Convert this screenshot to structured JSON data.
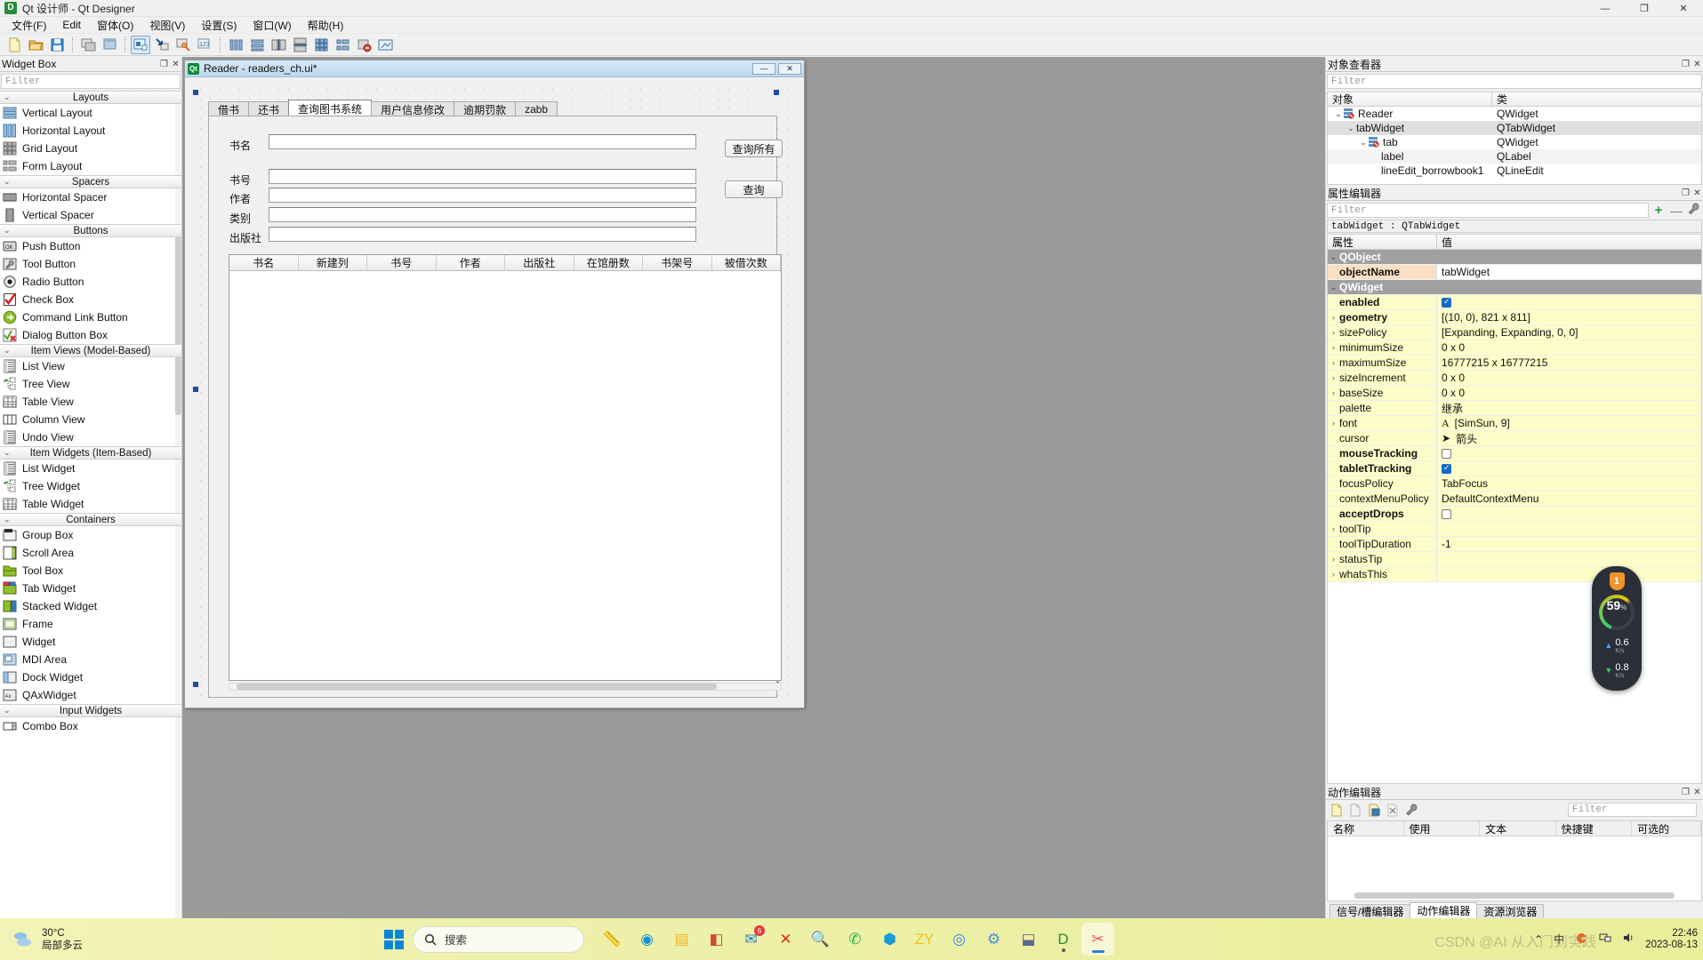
{
  "window": {
    "app_icon": "D",
    "title": "Qt 设计师 - Qt Designer",
    "minimize": "—",
    "maximize": "❐",
    "close": "✕"
  },
  "menubar": {
    "items": [
      "文件(F)",
      "Edit",
      "窗体(O)",
      "视图(V)",
      "设置(S)",
      "窗口(W)",
      "帮助(H)"
    ]
  },
  "toolbar": {
    "groups": [
      [
        "new-file-icon",
        "open-folder-icon",
        "save-icon"
      ],
      [
        "form-preview-icon",
        "form-layout-icon"
      ],
      [
        "edit-widgets-icon",
        "edit-signals-icon",
        "edit-buddies-icon",
        "edit-tab-order-icon"
      ],
      [
        "layout-horizontal-icon",
        "layout-vertical-icon",
        "layout-splitter-h-icon",
        "layout-splitter-v-icon",
        "layout-grid-icon",
        "layout-form-icon",
        "break-layout-icon",
        "adjust-size-icon"
      ]
    ]
  },
  "widget_box": {
    "title": "Widget Box",
    "float_btn": "❐",
    "close_btn": "✕",
    "filter_placeholder": "Filter",
    "categories": [
      {
        "name": "Layouts",
        "items": [
          {
            "label": "Vertical Layout",
            "icon": "vertical-layout-icon"
          },
          {
            "label": "Horizontal Layout",
            "icon": "horizontal-layout-icon"
          },
          {
            "label": "Grid Layout",
            "icon": "grid-layout-icon"
          },
          {
            "label": "Form Layout",
            "icon": "form-layout-icon"
          }
        ]
      },
      {
        "name": "Spacers",
        "items": [
          {
            "label": "Horizontal Spacer",
            "icon": "horizontal-spacer-icon"
          },
          {
            "label": "Vertical Spacer",
            "icon": "vertical-spacer-icon"
          }
        ]
      },
      {
        "name": "Buttons",
        "items": [
          {
            "label": "Push Button",
            "icon": "push-button-icon"
          },
          {
            "label": "Tool Button",
            "icon": "tool-button-icon"
          },
          {
            "label": "Radio Button",
            "icon": "radio-button-icon"
          },
          {
            "label": "Check Box",
            "icon": "check-box-icon"
          },
          {
            "label": "Command Link Button",
            "icon": "command-link-icon"
          },
          {
            "label": "Dialog Button Box",
            "icon": "dialog-button-box-icon"
          }
        ]
      },
      {
        "name": "Item Views (Model-Based)",
        "items": [
          {
            "label": "List View",
            "icon": "list-view-icon"
          },
          {
            "label": "Tree View",
            "icon": "tree-view-icon"
          },
          {
            "label": "Table View",
            "icon": "table-view-icon"
          },
          {
            "label": "Column View",
            "icon": "column-view-icon"
          },
          {
            "label": "Undo View",
            "icon": "undo-view-icon"
          }
        ]
      },
      {
        "name": "Item Widgets (Item-Based)",
        "items": [
          {
            "label": "List Widget",
            "icon": "list-widget-icon"
          },
          {
            "label": "Tree Widget",
            "icon": "tree-widget-icon"
          },
          {
            "label": "Table Widget",
            "icon": "table-widget-icon"
          }
        ]
      },
      {
        "name": "Containers",
        "items": [
          {
            "label": "Group Box",
            "icon": "group-box-icon"
          },
          {
            "label": "Scroll Area",
            "icon": "scroll-area-icon"
          },
          {
            "label": "Tool Box",
            "icon": "tool-box-icon"
          },
          {
            "label": "Tab Widget",
            "icon": "tab-widget-icon"
          },
          {
            "label": "Stacked Widget",
            "icon": "stacked-widget-icon"
          },
          {
            "label": "Frame",
            "icon": "frame-icon"
          },
          {
            "label": "Widget",
            "icon": "widget-icon"
          },
          {
            "label": "MDI Area",
            "icon": "mdi-area-icon"
          },
          {
            "label": "Dock Widget",
            "icon": "dock-widget-icon"
          },
          {
            "label": "QAxWidget",
            "icon": "qax-widget-icon"
          }
        ]
      },
      {
        "name": "Input Widgets",
        "items": [
          {
            "label": "Combo Box",
            "icon": "combo-box-icon"
          }
        ]
      }
    ]
  },
  "form_window": {
    "icon": "Qt",
    "title": "Reader - readers_ch.ui*",
    "minimize": "—",
    "close": "✕",
    "tabs": [
      "借书",
      "还书",
      "查询图书系统",
      "用户信息修改",
      "逾期罚款",
      "zabb"
    ],
    "selected_tab": "查询图书系统",
    "fields": [
      {
        "label": "书名",
        "value": ""
      },
      {
        "label": "书号",
        "value": ""
      },
      {
        "label": "作者",
        "value": ""
      },
      {
        "label": "类别",
        "value": ""
      },
      {
        "label": "出版社",
        "value": ""
      }
    ],
    "buttons": [
      "查询所有",
      "查询"
    ],
    "table_headers": [
      "书名",
      "新建列",
      "书号",
      "作者",
      "出版社",
      "在馆册数",
      "书架号",
      "被借次数"
    ]
  },
  "object_inspector": {
    "title": "对象查看器",
    "float_btn": "❐",
    "close_btn": "✕",
    "filter_placeholder": "Filter",
    "columns": [
      "对象",
      "类"
    ],
    "rows": [
      {
        "indent": 0,
        "twisty": "⌄",
        "icon": "widget-node-icon",
        "name": "Reader",
        "class": "QWidget",
        "selected": false
      },
      {
        "indent": 1,
        "twisty": "⌄",
        "icon": "",
        "name": "tabWidget",
        "class": "QTabWidget",
        "selected": true
      },
      {
        "indent": 2,
        "twisty": "⌄",
        "icon": "widget-node-icon",
        "name": "tab",
        "class": "QWidget",
        "selected": false
      },
      {
        "indent": 3,
        "twisty": "",
        "icon": "",
        "name": "label",
        "class": "QLabel",
        "selected": false
      },
      {
        "indent": 3,
        "twisty": "",
        "icon": "",
        "name": "lineEdit_borrowbook1",
        "class": "QLineEdit",
        "selected": false
      }
    ]
  },
  "property_editor": {
    "title": "属性编辑器",
    "float_btn": "❐",
    "close_btn": "✕",
    "filter_placeholder": "Filter",
    "add_btn": "+",
    "remove_btn": "—",
    "config_btn": "wrench-icon",
    "object_line": "tabWidget : QTabWidget",
    "columns": [
      "属性",
      "值"
    ],
    "rows": [
      {
        "kind": "group",
        "name": "QObject",
        "value": "",
        "twisty": "⌄"
      },
      {
        "kind": "peach",
        "name": "objectName",
        "value": "tabWidget",
        "bold": true,
        "twisty": ""
      },
      {
        "kind": "group",
        "name": "QWidget",
        "value": "",
        "twisty": "⌄"
      },
      {
        "kind": "yellow",
        "name": "enabled",
        "value": "",
        "checkbox": "on",
        "bold": true,
        "twisty": ""
      },
      {
        "kind": "yellow",
        "name": "geometry",
        "value": "[(10, 0), 821 x 811]",
        "bold": true,
        "twisty": "›"
      },
      {
        "kind": "yellow",
        "name": "sizePolicy",
        "value": "[Expanding, Expanding, 0, 0]",
        "bold": false,
        "twisty": "›"
      },
      {
        "kind": "yellow",
        "name": "minimumSize",
        "value": "0 x 0",
        "bold": false,
        "twisty": "›"
      },
      {
        "kind": "yellow",
        "name": "maximumSize",
        "value": "16777215 x 16777215",
        "bold": false,
        "twisty": "›"
      },
      {
        "kind": "yellow",
        "name": "sizeIncrement",
        "value": "0 x 0",
        "bold": false,
        "twisty": "›"
      },
      {
        "kind": "yellow",
        "name": "baseSize",
        "value": "0 x 0",
        "bold": false,
        "twisty": "›"
      },
      {
        "kind": "yellow",
        "name": "palette",
        "value": "继承",
        "bold": false,
        "twisty": ""
      },
      {
        "kind": "yellow",
        "name": "font",
        "value": "[SimSun, 9]",
        "bold": false,
        "twisty": "›",
        "valicon": "font-A-icon"
      },
      {
        "kind": "yellow",
        "name": "cursor",
        "value": "箭头",
        "bold": false,
        "twisty": "",
        "valicon": "cursor-arrow-icon"
      },
      {
        "kind": "yellow",
        "name": "mouseTracking",
        "value": "",
        "checkbox": "off",
        "bold": true,
        "twisty": ""
      },
      {
        "kind": "yellow",
        "name": "tabletTracking",
        "value": "",
        "checkbox": "on",
        "bold": true,
        "twisty": ""
      },
      {
        "kind": "yellow",
        "name": "focusPolicy",
        "value": "TabFocus",
        "bold": false,
        "twisty": ""
      },
      {
        "kind": "yellow",
        "name": "contextMenuPolicy",
        "value": "DefaultContextMenu",
        "bold": false,
        "twisty": ""
      },
      {
        "kind": "yellow",
        "name": "acceptDrops",
        "value": "",
        "checkbox": "off",
        "bold": true,
        "twisty": ""
      },
      {
        "kind": "yellow",
        "name": "toolTip",
        "value": "",
        "bold": false,
        "twisty": "›"
      },
      {
        "kind": "yellow",
        "name": "toolTipDuration",
        "value": "-1",
        "bold": false,
        "twisty": ""
      },
      {
        "kind": "yellow",
        "name": "statusTip",
        "value": "",
        "bold": false,
        "twisty": "›"
      },
      {
        "kind": "yellow",
        "name": "whatsThis",
        "value": "",
        "bold": false,
        "twisty": "›"
      }
    ]
  },
  "action_editor": {
    "title": "动作编辑器",
    "float_btn": "❐",
    "close_btn": "✕",
    "filter_placeholder": "Filter",
    "tools": [
      "new-action-icon",
      "copy-action-icon",
      "edit-action-icon",
      "delete-action-icon",
      "action-settings-icon"
    ],
    "columns": [
      "名称",
      "使用",
      "文本",
      "快捷键",
      "可选的"
    ],
    "rows": [],
    "bottom_tabs": [
      "信号/槽编辑器",
      "动作编辑器",
      "资源浏览器"
    ],
    "selected_bottom_tab": "动作编辑器"
  },
  "net_widget": {
    "shield_badge": "1",
    "cpu_percent": "59",
    "percent_symbol": "%",
    "upload_value": "0.6",
    "upload_unit": "K/s",
    "upload_arrow": "▲",
    "download_value": "0.8",
    "download_unit": "K/s",
    "download_arrow": "▼"
  },
  "taskbar": {
    "weather_temp": "30°C",
    "weather_desc": "局部多云",
    "weather_icon": "partly-cloudy-icon",
    "start_icon": "windows-start-icon",
    "search_placeholder": "搜索",
    "search_icon": "search-icon",
    "apps": [
      {
        "name": "ruler-app",
        "glyph": "📏",
        "color": "#c7a06a"
      },
      {
        "name": "edge-browser",
        "glyph": "◉",
        "color": "#1b8fd4"
      },
      {
        "name": "file-explorer",
        "glyph": "▤",
        "color": "#f0b429"
      },
      {
        "name": "notes-app",
        "glyph": "◧",
        "color": "#d14b3c"
      },
      {
        "name": "mail-app",
        "glyph": "✉",
        "color": "#2a7fc9",
        "badge": "6"
      },
      {
        "name": "close-app",
        "glyph": "✕",
        "color": "#d93025"
      },
      {
        "name": "search-app",
        "glyph": "🔍",
        "color": "#f5a623"
      },
      {
        "name": "wechat-app",
        "glyph": "✆",
        "color": "#2aab4f"
      },
      {
        "name": "qq-app",
        "glyph": "⬢",
        "color": "#1a9ad6"
      },
      {
        "name": "zy-app",
        "glyph": "ZY",
        "color": "#f2c21c"
      },
      {
        "name": "chrome-browser",
        "glyph": "◎",
        "color": "#3b84f2"
      },
      {
        "name": "settings-app",
        "glyph": "⚙",
        "color": "#4a8fd4"
      },
      {
        "name": "network-app",
        "glyph": "⬓",
        "color": "#5b6b8a"
      },
      {
        "name": "pycharm-app",
        "glyph": "D",
        "color": "#2a8a3c"
      },
      {
        "name": "qt-designer-app",
        "glyph": "✂",
        "color": "#e0544c"
      }
    ],
    "tray_up": "⌃",
    "tray_ime": "中",
    "clock_time": "22:46",
    "clock_date": "2023-08-13",
    "watermark": "CSDN @AI 从入门到实践"
  }
}
